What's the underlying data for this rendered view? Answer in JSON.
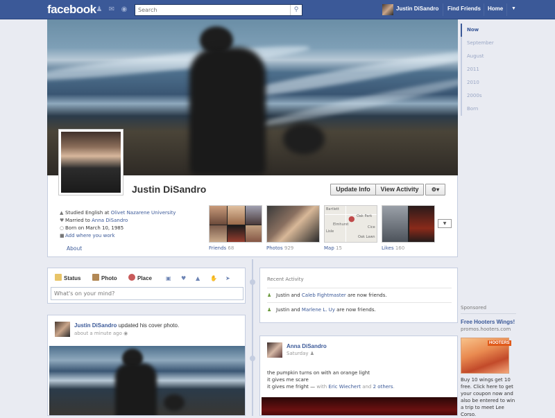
{
  "topbar": {
    "logo": "facebook",
    "search_placeholder": "Search",
    "user_name": "Justin DiSandro",
    "find_friends": "Find Friends",
    "home": "Home"
  },
  "profile": {
    "name": "Justin DiSandro",
    "update_info": "Update Info",
    "view_activity": "View Activity",
    "about_label": "About",
    "info": {
      "studied_prefix": "Studied English at ",
      "school": "Olivet Nazarene University",
      "married_prefix": "Married to ",
      "spouse": "Anna DiSandro",
      "born": "Born on March 10, 1985",
      "add_work": "Add where you work"
    },
    "tiles": [
      {
        "label": "Friends",
        "count": "68"
      },
      {
        "label": "Photos",
        "count": "929"
      },
      {
        "label": "Map",
        "count": "15"
      },
      {
        "label": "Likes",
        "count": "160"
      }
    ],
    "map_labels": [
      "Bartlett",
      "Oak Park",
      "Elmhurst",
      "Cice",
      "Lisle",
      "Oak Lawn"
    ]
  },
  "years": [
    "Now",
    "September",
    "August",
    "2011",
    "2010",
    "2000s",
    "Born"
  ],
  "composer": {
    "tabs": [
      "Status",
      "Photo",
      "Place"
    ],
    "placeholder": "What's on your mind?"
  },
  "activity": {
    "header": "Recent Activity",
    "rows": [
      {
        "prefix": "Justin and ",
        "friend": "Caleb Fightmaster",
        "suffix": " are now friends."
      },
      {
        "prefix": "Justin and ",
        "friend": "Marlene L. Uy",
        "suffix": " are now friends."
      }
    ]
  },
  "post1": {
    "author": "Justin DiSandro",
    "action": " updated his cover photo.",
    "time": "about a minute ago"
  },
  "post2": {
    "author": "Anna DiSandro",
    "time": "Saturday",
    "line1": "the pumpkin turns on with an orange light",
    "line2": "it gives me scare",
    "line3_prefix": "it gives me fright — ",
    "with": "with ",
    "tag1": "Eric Wiechert",
    "and": " and ",
    "tag2": "2 others",
    "end": "."
  },
  "ad": {
    "sponsored": "Sponsored",
    "title": "Free Hooters Wings!",
    "domain": "promos.hooters.com",
    "body": "Buy 10 wings get 10 free. Click here to get your coupon now and also be entered to win a trip to meet Lee Corso.",
    "img_text": "HOOTERS"
  }
}
